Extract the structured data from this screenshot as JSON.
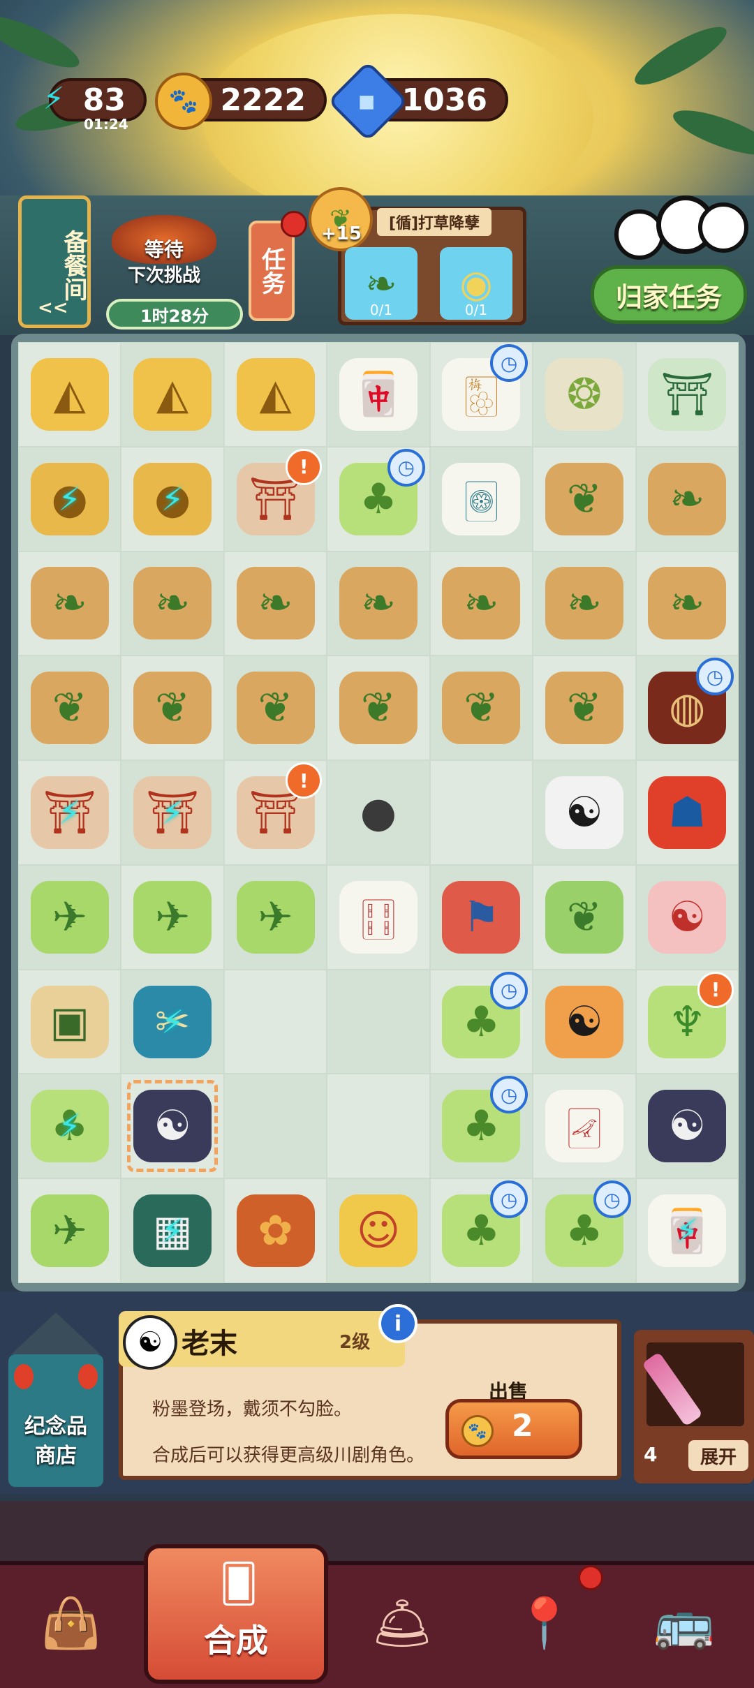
{
  "resources": {
    "energy": {
      "value": "83",
      "timer": "01:24",
      "icon": "lightning-icon"
    },
    "coins": {
      "value": "2222",
      "icon": "paw-coin-icon"
    },
    "gems": {
      "value": "1036",
      "icon": "blue-gem-icon"
    }
  },
  "pantry": {
    "label": "备餐间",
    "arrow": "<<"
  },
  "challenge": {
    "line1": "等待",
    "line2": "下次挑战",
    "timer": "1时28分"
  },
  "task_button": {
    "label": "任务"
  },
  "quest": {
    "reward": "+15",
    "title": "[循]打草降孽",
    "items": [
      {
        "icon": "bamboo-leaves-icon",
        "progress": "0/1"
      },
      {
        "icon": "noodle-plate-icon",
        "progress": "0/1"
      }
    ]
  },
  "home_task": {
    "label": "归家任务"
  },
  "board": {
    "rows": [
      [
        "gold-ingot",
        "gold-ingot",
        "gold-ingot",
        "mahjong-tile",
        "mahjong-tile-flower",
        "edamame-bowl",
        "pavilion"
      ],
      [
        "gold-coin-bolt",
        "gold-coin-bolt",
        "market-stall",
        "bamboo-shoot",
        "mahjong-tile-round",
        "leaf-basket",
        "leaf-basket-scoop"
      ],
      [
        "leaf-basket-scoop",
        "leaf-basket-scoop",
        "leaf-basket-scoop",
        "leaf-basket-scoop",
        "leaf-basket-scoop",
        "leaf-basket-scoop",
        "leaf-basket-scoop"
      ],
      [
        "leaf-basket",
        "leaf-basket",
        "leaf-basket",
        "leaf-basket",
        "leaf-basket",
        "leaf-basket",
        "lacquer-box"
      ],
      [
        "market-stall-bolt",
        "market-stall-bolt",
        "market-stall",
        "sunflower-seed",
        "",
        "panda-waiter",
        "opera-mask-red"
      ],
      [
        "dragonfly",
        "dragonfly",
        "dragonfly",
        "mahjong-tile-bamboo",
        "opera-flag",
        "tea-leaf",
        "opera-panda"
      ],
      [
        "plant-crate",
        "sewing-kit-bolt",
        "",
        "",
        "bamboo-shoot",
        "panda-eating",
        "bamboo-plant"
      ],
      [
        "bamboo-shoot-bolt",
        "opera-panda-black",
        "",
        "",
        "bamboo-shoot",
        "mahjong-tile-small",
        "opera-panda-black"
      ],
      [
        "dragonfly",
        "mahjong-table-bolt",
        "fried-snack",
        "monkey-mask",
        "bamboo-shoot",
        "bamboo-shoot",
        "mahjong-tile-bolt"
      ]
    ]
  },
  "selected": {
    "name": "老末",
    "level": "2级",
    "desc1": "粉墨登场，戴须不勾脸。",
    "desc2": "合成后可以获得更高级川剧角色。",
    "sell_label": "出售",
    "sell_price": "2"
  },
  "shop": {
    "line1": "纪念品",
    "line2": "商店"
  },
  "inventory": {
    "count": "4",
    "expand": "展开"
  },
  "nav": {
    "active_label": "合成"
  }
}
